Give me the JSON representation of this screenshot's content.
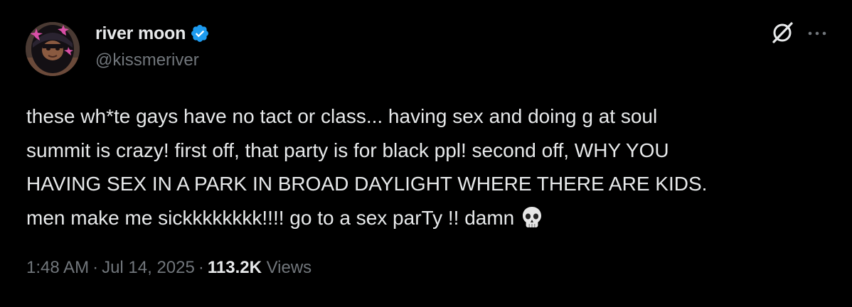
{
  "author": {
    "display_name": "river moon",
    "handle": "@kissmeriver",
    "verified": true
  },
  "tweet": {
    "lines": [
      "these wh*te gays have no tact or class... having sex and doing g at soul",
      "summit is crazy! first off, that party is for black ppl! second off, WHY YOU",
      "HAVING SEX IN A PARK IN BROAD DAYLIGHT WHERE THERE ARE KIDS.",
      "men make me sickkkkkkkk!!!! go to a sex parTy !! damn"
    ],
    "emoji": "skull"
  },
  "meta": {
    "time": "1:48 AM",
    "date": "Jul 14, 2025",
    "views_count": "113.2K",
    "views_label": "Views",
    "separator": "·"
  },
  "icons": {
    "verified": "verified-badge-icon",
    "grok": "grok-icon",
    "more": "more-icon",
    "emoji": "skull-emoji-icon"
  },
  "colors": {
    "background": "#000000",
    "text_primary": "#e7e9ea",
    "text_secondary": "#71767b",
    "verified_blue": "#1d9bf0"
  }
}
